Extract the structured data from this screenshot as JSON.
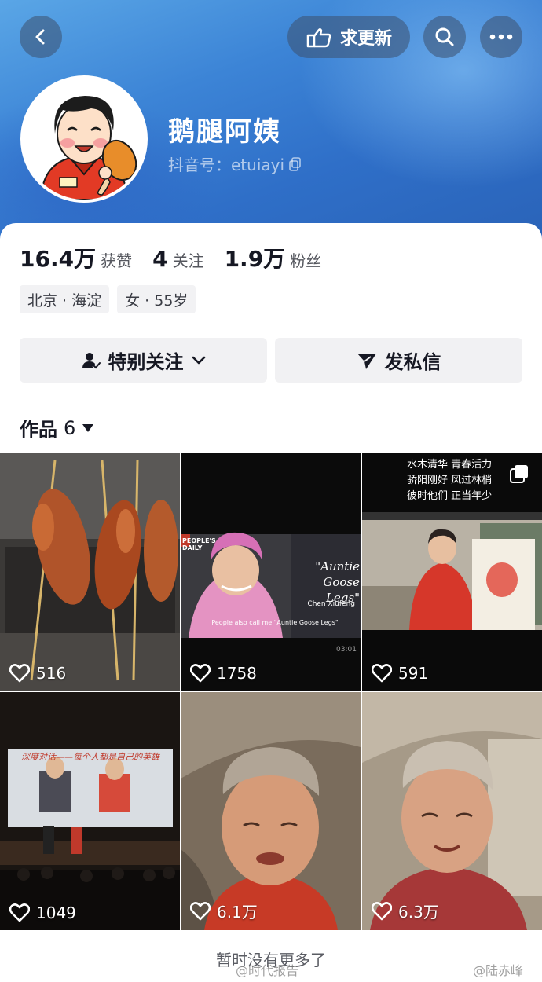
{
  "header": {
    "update_label": "求更新",
    "icons": [
      "back-icon",
      "update-hand-icon",
      "search-icon",
      "more-icon"
    ]
  },
  "profile": {
    "name": "鹅腿阿姨",
    "id_label": "抖音号：etuiayi",
    "avatar_text": "鹅腿阿姨"
  },
  "stats": [
    {
      "value": "16.4万",
      "label": "获赞"
    },
    {
      "value": "4",
      "label": "关注"
    },
    {
      "value": "1.9万",
      "label": "粉丝"
    }
  ],
  "tags": [
    "北京 · 海淀",
    "女 · 55岁"
  ],
  "actions": {
    "follow_label": "特别关注",
    "message_label": "发私信"
  },
  "works": {
    "label": "作品",
    "count": "6"
  },
  "videos": [
    {
      "likes": "516"
    },
    {
      "likes": "1758",
      "overlay_title": "\"Auntie Goose Legs\"",
      "overlay_name": "Chen Xiufeng",
      "overlay_caption": "People also call me \"Auntie Goose Legs\"",
      "overlay_source": "PEOPLE'S DAILY",
      "duration": "03:01"
    },
    {
      "likes": "591",
      "overlay_lines": [
        "水木清华 青春活力",
        "骄阳刚好 风过林梢",
        "彼时他们 正当年少"
      ]
    },
    {
      "likes": "1049",
      "overlay_banner": "深度对话——每个人都是自己的英雄"
    },
    {
      "likes": "6.1万"
    },
    {
      "likes": "6.3万"
    }
  ],
  "footer": {
    "no_more": "暂时没有更多了",
    "watermark_left": "@时代报告",
    "watermark_right": "@陆赤峰"
  },
  "colors": {
    "header_blue": "#3c84d6",
    "text_primary": "#161823"
  }
}
